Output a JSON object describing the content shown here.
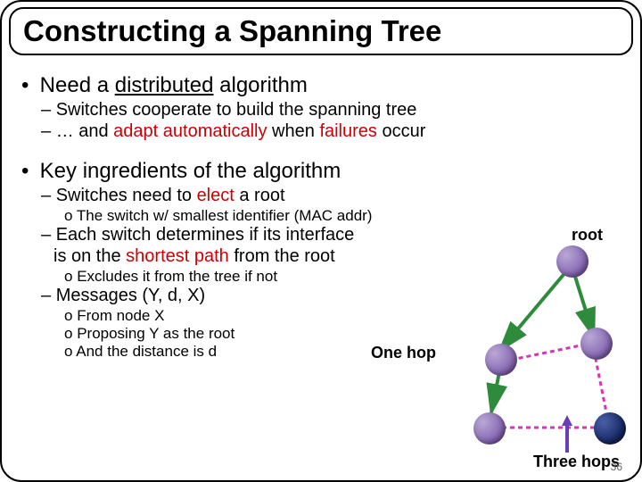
{
  "title": "Constructing a Spanning Tree",
  "bullets": {
    "b1a": "Need a ",
    "b1a_u": "distributed",
    "b1a_tail": " algorithm",
    "b2a": "Switches cooperate to build the spanning tree",
    "b2b_pre": "… and ",
    "b2b_red1": "adapt automatically",
    "b2b_mid": " when ",
    "b2b_red2": "failures",
    "b2b_tail": " occur",
    "b1b": "Key ingredients of the algorithm",
    "b2c_pre": "Switches need to ",
    "b2c_red": "elect",
    "b2c_tail": " a root",
    "b3a": "The switch w/ smallest identifier (MAC addr)",
    "b2d_l1": "Each switch determines if its interface",
    "b2d_l2_pre": "is on the ",
    "b2d_l2_red": "shortest path",
    "b2d_l2_tail": " from the root",
    "b3b": "Excludes it from the tree if not",
    "b2e": "Messages (Y, d, X)",
    "b3c": "From node X",
    "b3d": "Proposing Y as the root",
    "b3e": "And the distance is d"
  },
  "labels": {
    "root": "root",
    "one_hop": "One hop",
    "three_hops": "Three hops"
  },
  "page_number": "36"
}
